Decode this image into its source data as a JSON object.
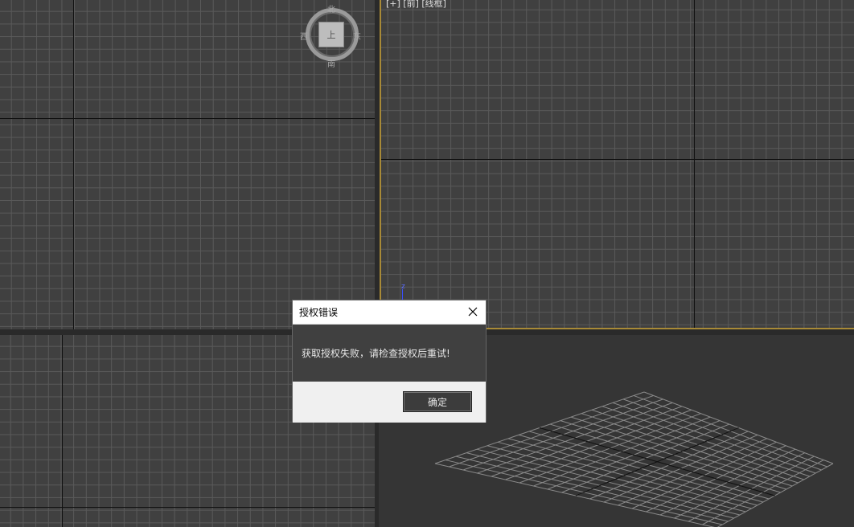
{
  "viewports": {
    "front_label": "[+] [前] [线框]"
  },
  "viewcube": {
    "face": "上",
    "north": "北",
    "south": "南",
    "west": "西",
    "east": "东"
  },
  "gizmo": {
    "z_axis_label": "z"
  },
  "dialog": {
    "title": "授权错误",
    "message": "获取授权失败，请检查授权后重试!",
    "ok_label": "确定"
  },
  "colors": {
    "active_viewport_border": "#a88a37",
    "grid_background": "#404040",
    "grid_line": "#5a5a5a"
  }
}
